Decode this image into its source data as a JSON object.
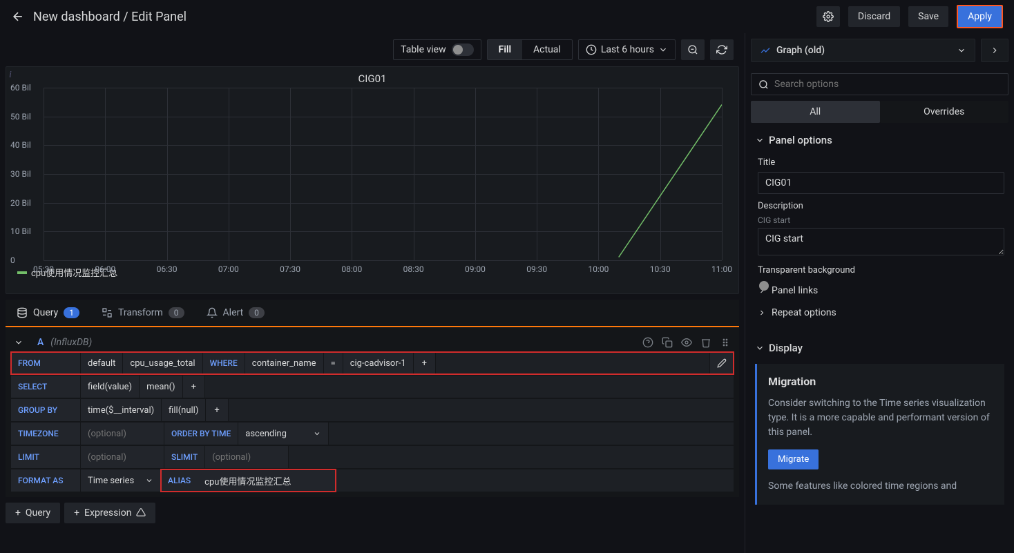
{
  "header": {
    "breadcrumb": "New dashboard / Edit Panel",
    "discard": "Discard",
    "save": "Save",
    "apply": "Apply"
  },
  "toolbar": {
    "table_view": "Table view",
    "fill": "Fill",
    "actual": "Actual",
    "time_range": "Last 6 hours"
  },
  "viz_picker": {
    "label": "Graph (old)"
  },
  "search": {
    "placeholder": "Search options"
  },
  "side_tabs": {
    "all": "All",
    "overrides": "Overrides"
  },
  "panel_options": {
    "header": "Panel options",
    "title_label": "Title",
    "title_value": "CIG01",
    "desc_label": "Description",
    "desc_sublabel": "CIG start",
    "desc_value": "CIG start",
    "transparent_label": "Transparent background",
    "panel_links": "Panel links",
    "repeat_options": "Repeat options"
  },
  "display": {
    "header": "Display",
    "migration_title": "Migration",
    "migration_body": "Consider switching to the Time series visualization type. It is a more capable and performant version of this panel.",
    "migrate_btn": "Migrate",
    "migration_note": "Some features like colored time regions and"
  },
  "chart": {
    "title": "CIG01",
    "legend": "cpu使用情况监控汇总"
  },
  "chart_data": {
    "type": "line",
    "title": "CIG01",
    "xlabel": "",
    "ylabel": "",
    "ylim": [
      0,
      60000000000
    ],
    "y_ticks": [
      "0",
      "10 Bil",
      "20 Bil",
      "30 Bil",
      "40 Bil",
      "50 Bil",
      "60 Bil"
    ],
    "x_ticks": [
      "05:30",
      "06:00",
      "06:30",
      "07:00",
      "07:30",
      "08:00",
      "08:30",
      "09:00",
      "09:30",
      "10:00",
      "10:30",
      "11:00"
    ],
    "series": [
      {
        "name": "cpu使用情况监控汇总",
        "color": "#73bf69",
        "x": [
          "10:10",
          "11:00"
        ],
        "values": [
          0,
          54000000000
        ]
      }
    ]
  },
  "query_tabs": {
    "query": "Query",
    "query_count": "1",
    "transform": "Transform",
    "transform_count": "0",
    "alert": "Alert",
    "alert_count": "0"
  },
  "query": {
    "letter": "A",
    "datasource": "(InfluxDB)",
    "from": "FROM",
    "from_default": "default",
    "from_measurement": "cpu_usage_total",
    "where": "WHERE",
    "where_field": "container_name",
    "where_op": "=",
    "where_value": "cig-cadvisor-1",
    "plus": "+",
    "select": "SELECT",
    "select_field": "field(value)",
    "select_agg": "mean()",
    "group_by": "GROUP BY",
    "group_time": "time($__interval)",
    "group_fill": "fill(null)",
    "timezone": "TIMEZONE",
    "optional": "(optional)",
    "order_by": "ORDER BY TIME",
    "order_val": "ascending",
    "limit": "LIMIT",
    "slimit": "SLIMIT",
    "format_as": "FORMAT AS",
    "format_val": "Time series",
    "alias": "ALIAS",
    "alias_val": "cpu使用情况监控汇总"
  },
  "add": {
    "query": "Query",
    "expression": "Expression"
  }
}
